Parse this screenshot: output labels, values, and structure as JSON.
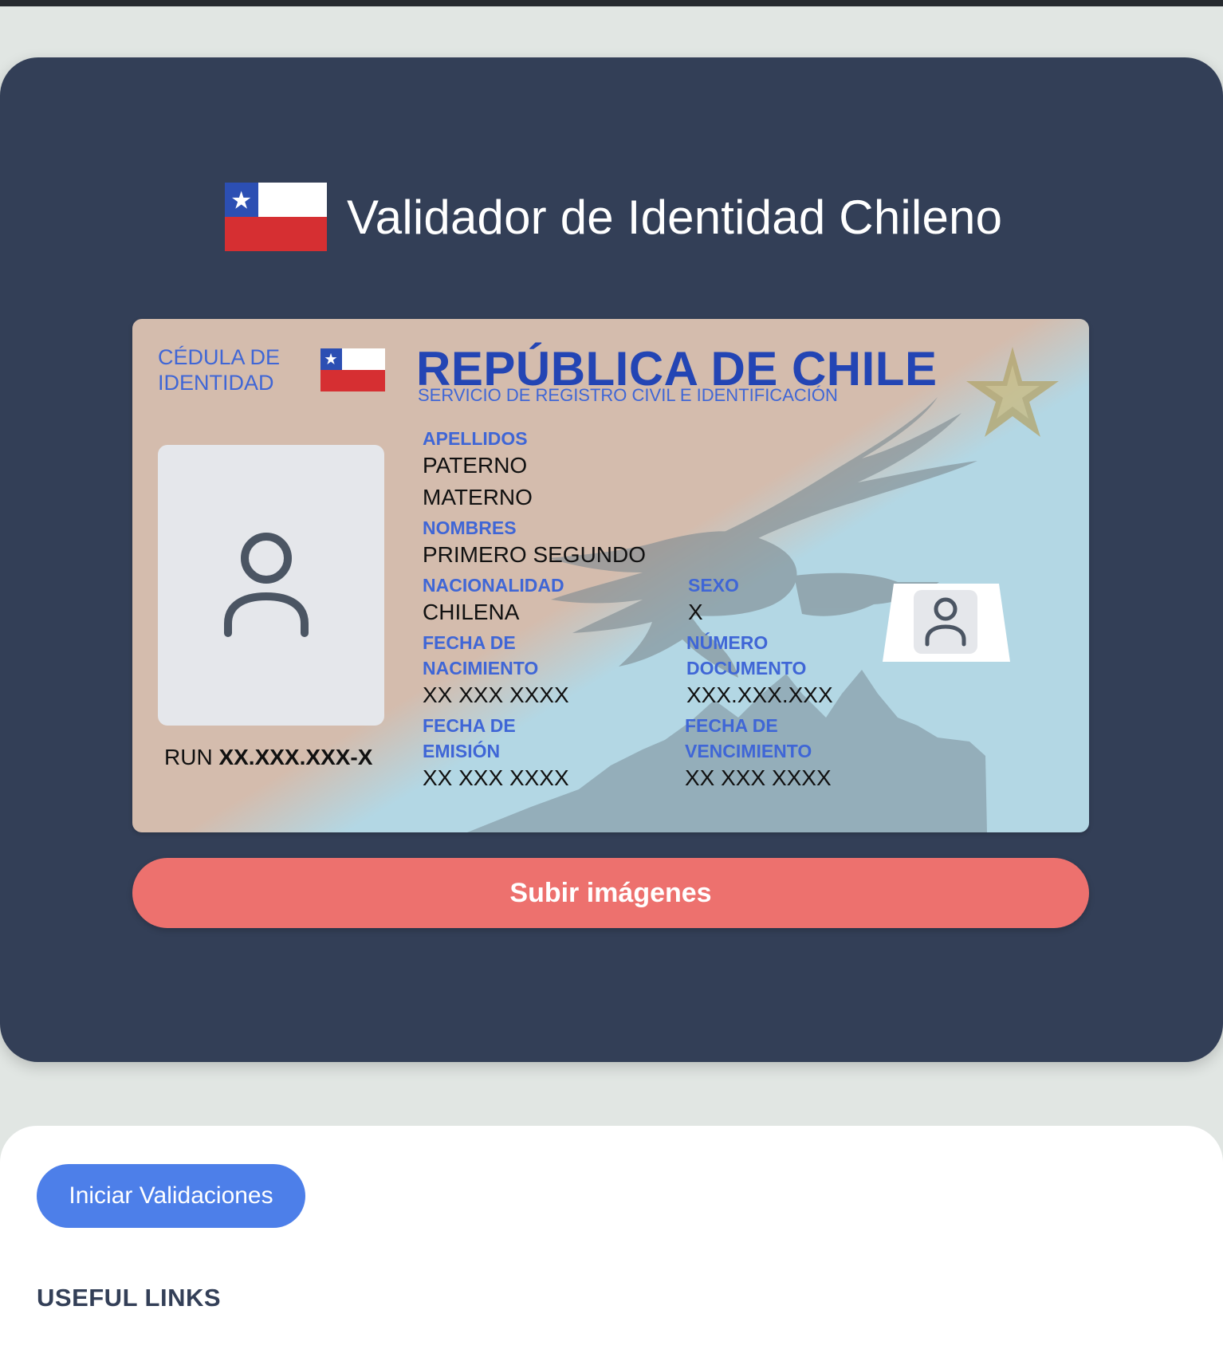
{
  "header": {
    "title": "Validador de Identidad Chileno",
    "flag_icon": "chile-flag-icon"
  },
  "colors": {
    "page_background": "#e1e6e3",
    "hero_background": "#333f57",
    "card_label": "#3f66d6",
    "card_title": "#2345b4",
    "upload_button": "#ed716e",
    "start_button": "#4d7fe9",
    "flag_blue": "#2c4fb3",
    "flag_red": "#d62f32"
  },
  "id_card": {
    "doc_type": "CÉDULA DE IDENTIDAD",
    "country": "REPÚBLICA DE CHILE",
    "issuer": "SERVICIO DE REGISTRO CIVIL E IDENTIFICACIÓN",
    "photo_icon": "user-icon",
    "run_label": "RUN",
    "run_value": "XX.XXX.XXX-X",
    "fields": {
      "apellidos_label": "APELLIDOS",
      "paterno": "PATERNO",
      "materno": "MATERNO",
      "nombres_label": "NOMBRES",
      "nombres": "PRIMERO SEGUNDO",
      "nacionalidad_label": "NACIONALIDAD",
      "nacionalidad": "CHILENA",
      "sexo_label": "SEXO",
      "sexo": "X",
      "fecha_nacimiento_label": "FECHA DE NACIMIENTO",
      "fecha_nacimiento": "XX XXX XXXX",
      "numero_documento_label": "NÚMERO DOCUMENTO",
      "numero_documento": "XXX.XXX.XXX",
      "fecha_emision_label": "FECHA DE EMISIÓN",
      "fecha_emision": "XX XXX XXXX",
      "fecha_vencimiento_label": "FECHA DE VENCIMIENTO",
      "fecha_vencimiento": "XX XXX XXXX"
    }
  },
  "actions": {
    "upload_label": "Subir imágenes",
    "start_label": "Iniciar Validaciones"
  },
  "footer": {
    "links_title": "USEFUL LINKS"
  }
}
